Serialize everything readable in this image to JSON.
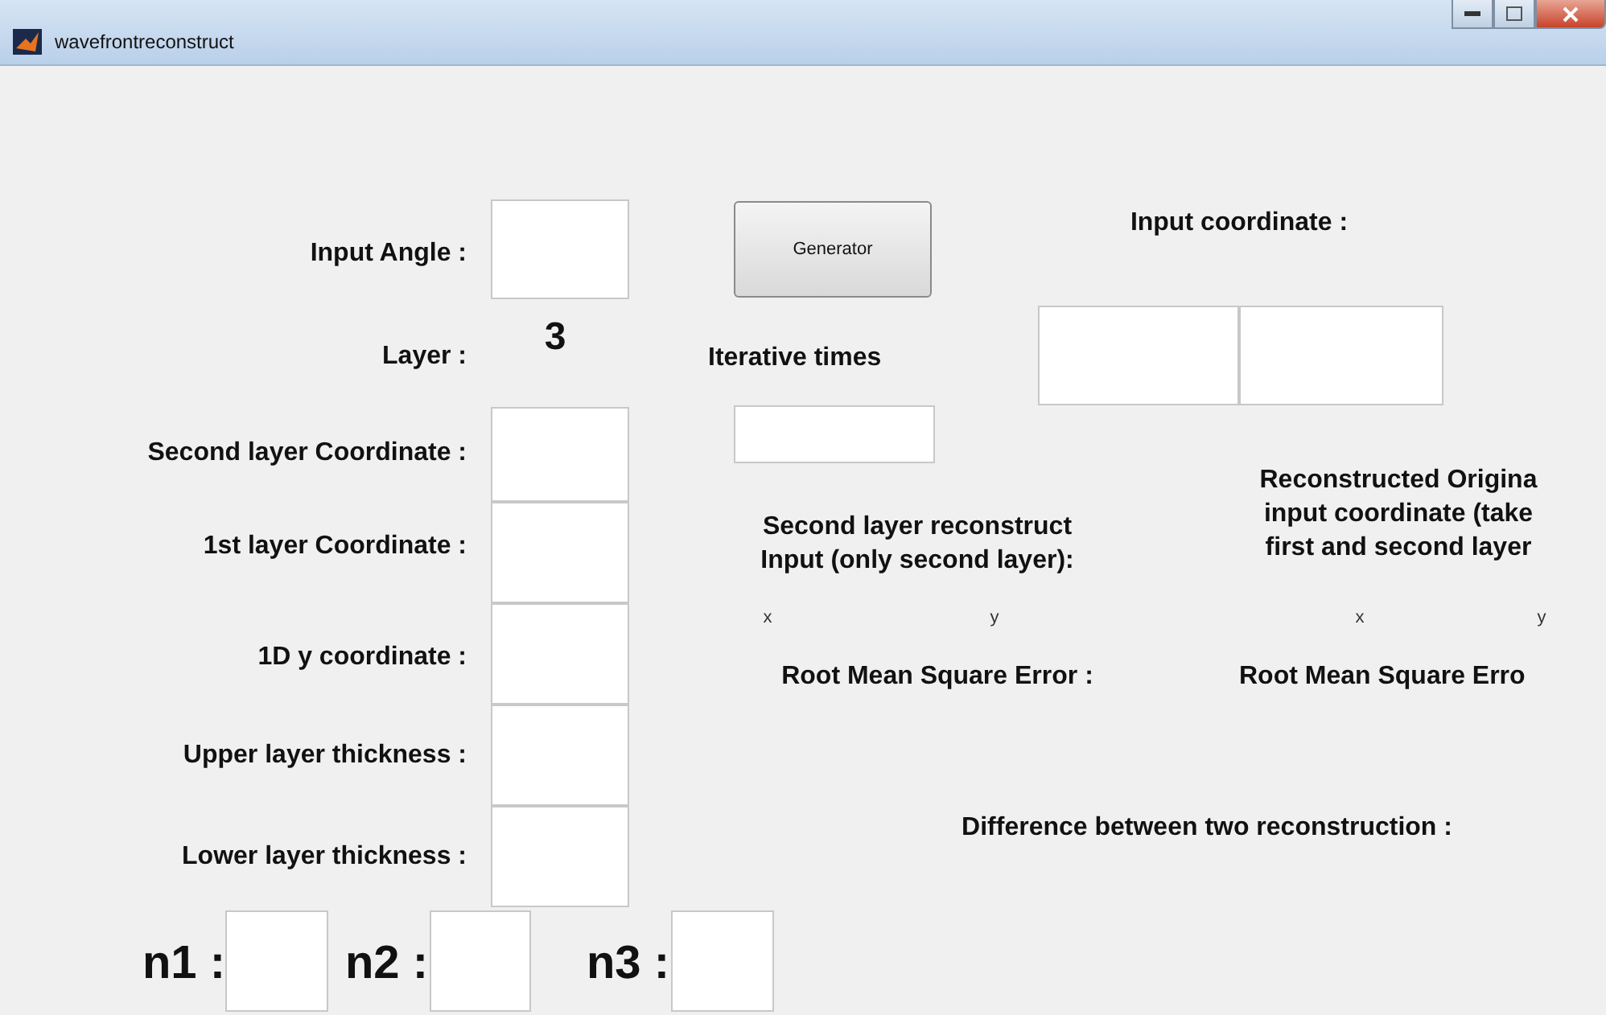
{
  "window": {
    "title": "wavefrontreconstruct"
  },
  "items": [
    {
      "kind": "label",
      "text": "Input Angle :"
    },
    {
      "kind": "field"
    },
    {
      "kind": "button",
      "text": "Generator"
    },
    {
      "kind": "label",
      "text": "Input coordinate :"
    },
    {
      "kind": "value",
      "text": "3"
    },
    {
      "kind": "label",
      "text": "Layer :"
    },
    {
      "kind": "label",
      "text": "Iterative times"
    },
    {
      "kind": "field"
    },
    {
      "kind": "field"
    },
    {
      "kind": "field"
    },
    {
      "kind": "label",
      "text": "Second layer Coordinate :"
    },
    {
      "kind": "field"
    },
    {
      "kind": "label",
      "text": "1st layer Coordinate :"
    },
    {
      "kind": "field"
    },
    {
      "kind": "block",
      "lines": [
        "Second layer reconstruct",
        "Input (only second layer):"
      ]
    },
    {
      "kind": "block",
      "lines": [
        "Reconstructed Origina",
        "input coordinate (take",
        "first and second layer"
      ]
    },
    {
      "kind": "small",
      "text": "x"
    },
    {
      "kind": "small",
      "text": "y"
    },
    {
      "kind": "small",
      "text": "x"
    },
    {
      "kind": "small",
      "text": "y"
    },
    {
      "kind": "label",
      "text": "1D y coordinate :"
    },
    {
      "kind": "field"
    },
    {
      "kind": "label",
      "text": "Root Mean Square Error :"
    },
    {
      "kind": "label",
      "text": "Root Mean Square Erro"
    },
    {
      "kind": "label",
      "text": "Upper layer thickness :"
    },
    {
      "kind": "field"
    },
    {
      "kind": "label",
      "text": "Lower layer thickness :"
    },
    {
      "kind": "field"
    },
    {
      "kind": "label",
      "text": "Difference between two reconstruction :"
    },
    {
      "kind": "big",
      "text": "n1 :"
    },
    {
      "kind": "field"
    },
    {
      "kind": "big",
      "text": "n2 :"
    },
    {
      "kind": "field"
    },
    {
      "kind": "big",
      "text": "n3 :"
    },
    {
      "kind": "field"
    }
  ]
}
